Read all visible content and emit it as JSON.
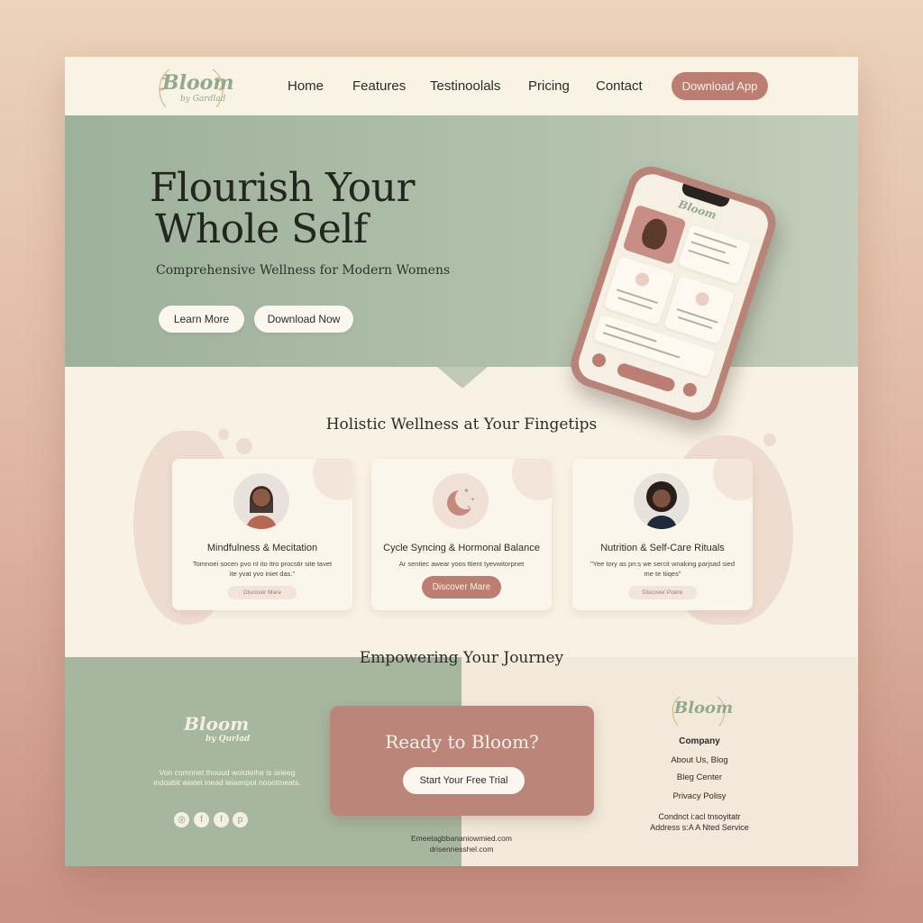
{
  "brand": {
    "name": "Bloom",
    "tagline": "by Gardlad",
    "accent": "#bc7e73",
    "sage": "#a6b69f",
    "cream": "#f8f2e5"
  },
  "nav": {
    "links": [
      "Home",
      "Features",
      "Testinoolals",
      "Pricing",
      "Contact"
    ],
    "cta": "Download App"
  },
  "hero": {
    "title_line1": "Flourish Your",
    "title_line2": "Whole Self",
    "subtitle": "Comprehensive Wellness for Modern Womens",
    "btn_learn": "Learn More",
    "btn_download": "Download Now"
  },
  "phone": {
    "logo": "Bloom"
  },
  "features": {
    "title": "Holistic Wellness at Your Fingetips",
    "cards": [
      {
        "title": "Mindfulness & Mecitation",
        "desc": "Tomnoei socen pvo nI ito itro procstir site tavet ite yvat yvo iniet das.\"",
        "button": "Discover Mare",
        "icon": "woman-portrait-icon"
      },
      {
        "title": "Cycle Syncing & Hormonal Balance",
        "desc": "Ar sentiec awear yoos ttient tyevwitorpnet",
        "button": "Discover Mare",
        "icon": "moon-stars-icon"
      },
      {
        "title": "Nutrition & Self-Care Rituals",
        "desc": "\"Yee tory as pn:s we sercit wnaking parjsad sied me te tiiqes\"",
        "button": "Discover Poere",
        "icon": "woman-portrait-icon"
      }
    ]
  },
  "journey": {
    "title": "Empowering Your Journey"
  },
  "footer": {
    "logo": "Bloom",
    "logo_sub": "by Qurlad",
    "desc": "Von comnnet thouud woioteihe is arieeg indoabit wiatet inead leiaenpot noontmeats.",
    "social": [
      "instagram-icon",
      "facebook-icon",
      "facebook-icon",
      "pinterest-icon"
    ],
    "cta_title": "Ready to Bloom?",
    "cta_button": "Start Your Free Trial",
    "email1": "Emeetagbbananiowmied.com",
    "email2": "drisennesshel.com",
    "right_logo": "Bloom",
    "company_heading": "Company",
    "links": [
      "About Us, Blog",
      "Bleg Center",
      "Privacy Polisy"
    ],
    "contact_line1": "Condnct i:acl tnsoyitatr",
    "contact_line2": "Address s:A A Nted Service"
  }
}
